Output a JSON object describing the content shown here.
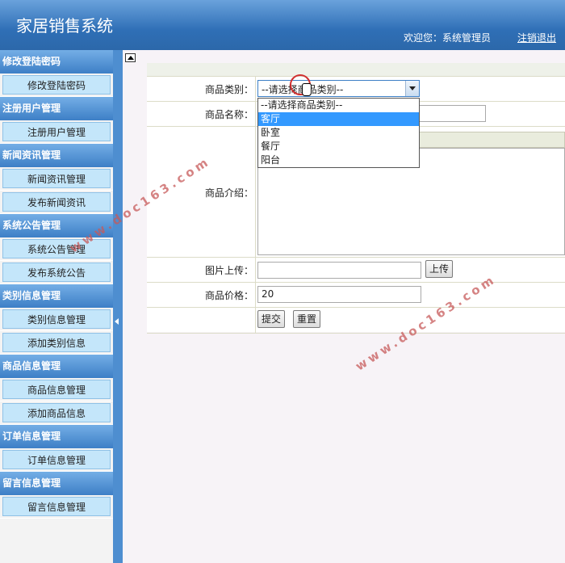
{
  "header": {
    "app_title": "家居销售系统",
    "welcome": "欢迎您：系统管理员",
    "logout": "注销退出"
  },
  "sidebar": {
    "groups": [
      {
        "title": "修改登陆密码",
        "items": [
          "修改登陆密码"
        ]
      },
      {
        "title": "注册用户管理",
        "items": [
          "注册用户管理"
        ]
      },
      {
        "title": "新闻资讯管理",
        "items": [
          "新闻资讯管理",
          "发布新闻资讯"
        ]
      },
      {
        "title": "系统公告管理",
        "items": [
          "系统公告管理",
          "发布系统公告"
        ]
      },
      {
        "title": "类别信息管理",
        "items": [
          "类别信息管理",
          "添加类别信息"
        ]
      },
      {
        "title": "商品信息管理",
        "items": [
          "商品信息管理",
          "添加商品信息"
        ]
      },
      {
        "title": "订单信息管理",
        "items": [
          "订单信息管理"
        ]
      },
      {
        "title": "留言信息管理",
        "items": [
          "留言信息管理"
        ]
      }
    ]
  },
  "form": {
    "category_label": "商品类别：",
    "category_selected": "--请选择商品类别--",
    "category_options": [
      "--请选择商品类别--",
      "客厅",
      "卧室",
      "餐厅",
      "阳台"
    ],
    "highlighted_option_index": 1,
    "name_label": "商品名称：",
    "name_value": "",
    "intro_label": "商品介绍：",
    "image_label": "图片上传：",
    "image_value": "",
    "upload_button": "上传",
    "price_label": "商品价格：",
    "price_value": "20",
    "submit_button": "提交",
    "reset_button": "重置"
  },
  "watermark": "www.doc163.com"
}
